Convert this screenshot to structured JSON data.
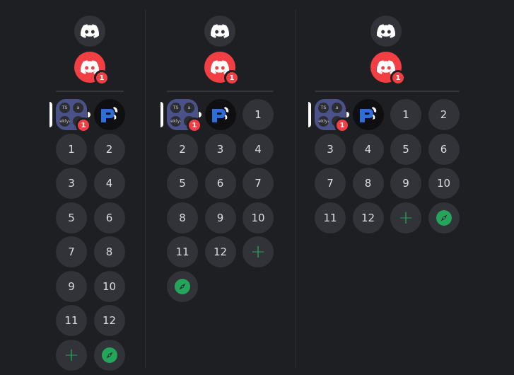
{
  "colors": {
    "accent_green": "#23a55a",
    "badge_red": "#f23f43",
    "folder": "#4a5289"
  },
  "icons": {
    "discord": "discord-logo-icon",
    "add": "add-server-icon",
    "explore": "compass-icon"
  },
  "folder": {
    "minis": [
      "TS",
      "a",
      "Steklyan",
      ""
    ]
  },
  "notification_badge": "1",
  "add_label": "+",
  "columns": [
    {
      "servers": [
        "1",
        "2",
        "3",
        "4",
        "5",
        "6",
        "7",
        "8",
        "9",
        "10",
        "11",
        "12"
      ]
    },
    {
      "servers": [
        "1",
        "2",
        "3",
        "4",
        "5",
        "6",
        "7",
        "8",
        "9",
        "10",
        "11",
        "12"
      ]
    },
    {
      "servers": [
        "1",
        "2",
        "3",
        "4",
        "5",
        "6",
        "7",
        "8",
        "9",
        "10",
        "11",
        "12"
      ]
    }
  ]
}
